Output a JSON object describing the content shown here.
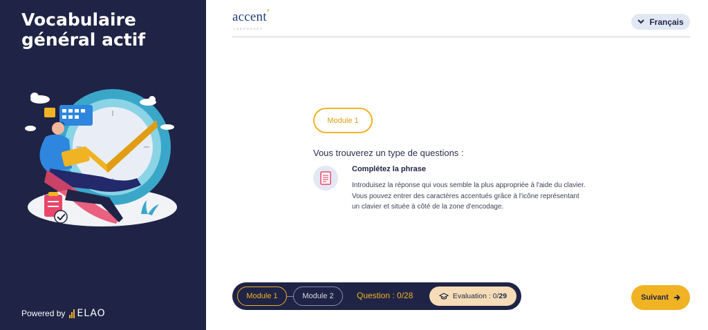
{
  "sidebar": {
    "title_line1": "Vocabulaire",
    "title_line2": "général actif",
    "powered_by": "Powered by",
    "powered_brand": "ELAO"
  },
  "header": {
    "brand_name": "accent",
    "brand_tick": "’",
    "brand_sub": "LANGUAGES",
    "language_button": "Français",
    "language_icon": "chevron-down-icon"
  },
  "main": {
    "module_pill": "Module 1",
    "intro": "Vous trouverez un type de questions :",
    "question_type": {
      "icon": "document-icon",
      "title": "Complétez la phrase",
      "description_lines": [
        "Introduisez la réponse qui vous semble la plus appropriée à l'aide du clavier.",
        "Vous pouvez entrer des caractères accentués grâce à l'icône représentant",
        "un clavier et située à côté de la zone d'encodage."
      ]
    }
  },
  "footer": {
    "module_tabs": [
      "Module 1",
      "Module 2"
    ],
    "question_counter": "Question : 0/28",
    "evaluation_label": "Evaluation : 0/",
    "evaluation_total": "29",
    "evaluation_icon": "graduation-cap-icon",
    "next_button": "Suivant",
    "next_icon": "arrow-right-icon"
  },
  "colors": {
    "sidebar_bg": "#1f2446",
    "accent_yellow": "#f0b323",
    "brand_blue": "#1f3f77",
    "brand_green": "#a8c64a",
    "language_btn_bg": "#e1e8f4",
    "eval_pill_bg": "#f6ddb7"
  }
}
